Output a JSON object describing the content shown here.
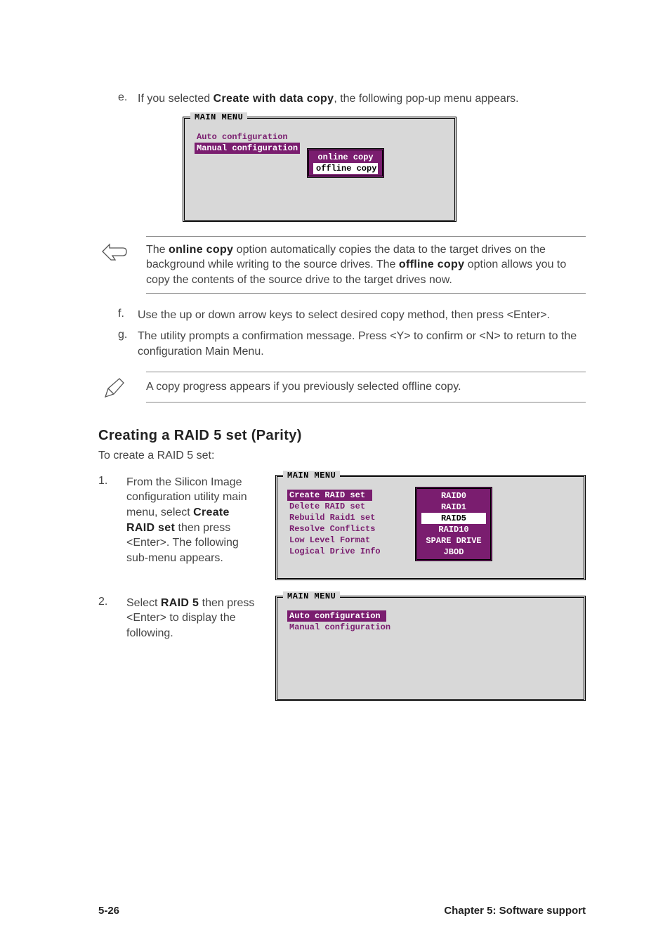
{
  "step_e": {
    "letter": "e.",
    "pre": "If you selected ",
    "bold": "Create with data copy",
    "post": ", the following pop-up menu appears."
  },
  "menu1": {
    "title": "MAIN MENU",
    "items": [
      "Auto configuration",
      "Manual configuration"
    ],
    "sub": [
      "online copy",
      "offline copy"
    ]
  },
  "note1": {
    "p1a": "The ",
    "p1b": "online copy",
    "p1c": " option automatically copies the data to the target drives on the background while writing to the source drives. The ",
    "p1d": "offline copy",
    "p1e": " option allows you to copy the contents of the source drive to the target drives now."
  },
  "step_f": {
    "letter": "f.",
    "text": "Use the up or down arrow keys to select desired copy method, then press <Enter>."
  },
  "step_g": {
    "letter": "g.",
    "text": "The utility prompts a confirmation message. Press <Y> to confirm or <N> to return to the configuration Main Menu."
  },
  "note2": "A copy progress appears if you previously selected offline copy.",
  "section": {
    "heading": "Creating a RAID 5 set (Parity)",
    "intro": "To create a RAID 5 set:"
  },
  "step1": {
    "num": "1.",
    "pre": "From the Silicon Image configuration utility main menu, select ",
    "bold": "Create RAID set",
    "post": " then press <Enter>. The following sub-menu appears."
  },
  "menu2": {
    "title": "MAIN MENU",
    "items": [
      "Create RAID set",
      "Delete RAID set",
      "Rebuild Raid1 set",
      "Resolve Conflicts",
      "Low Level Format",
      "Logical Drive Info"
    ],
    "sub": [
      "RAID0",
      "RAID1",
      "RAID5",
      "RAID10",
      "SPARE DRIVE",
      "JBOD"
    ]
  },
  "step2": {
    "num": "2.",
    "pre": "Select ",
    "bold": "RAID 5",
    "post": " then press <Enter> to display the following."
  },
  "menu3": {
    "title": "MAIN MENU",
    "items": [
      "Auto configuration",
      "Manual configuration"
    ]
  },
  "footer": {
    "left": "5-26",
    "right": "Chapter 5: Software support"
  }
}
